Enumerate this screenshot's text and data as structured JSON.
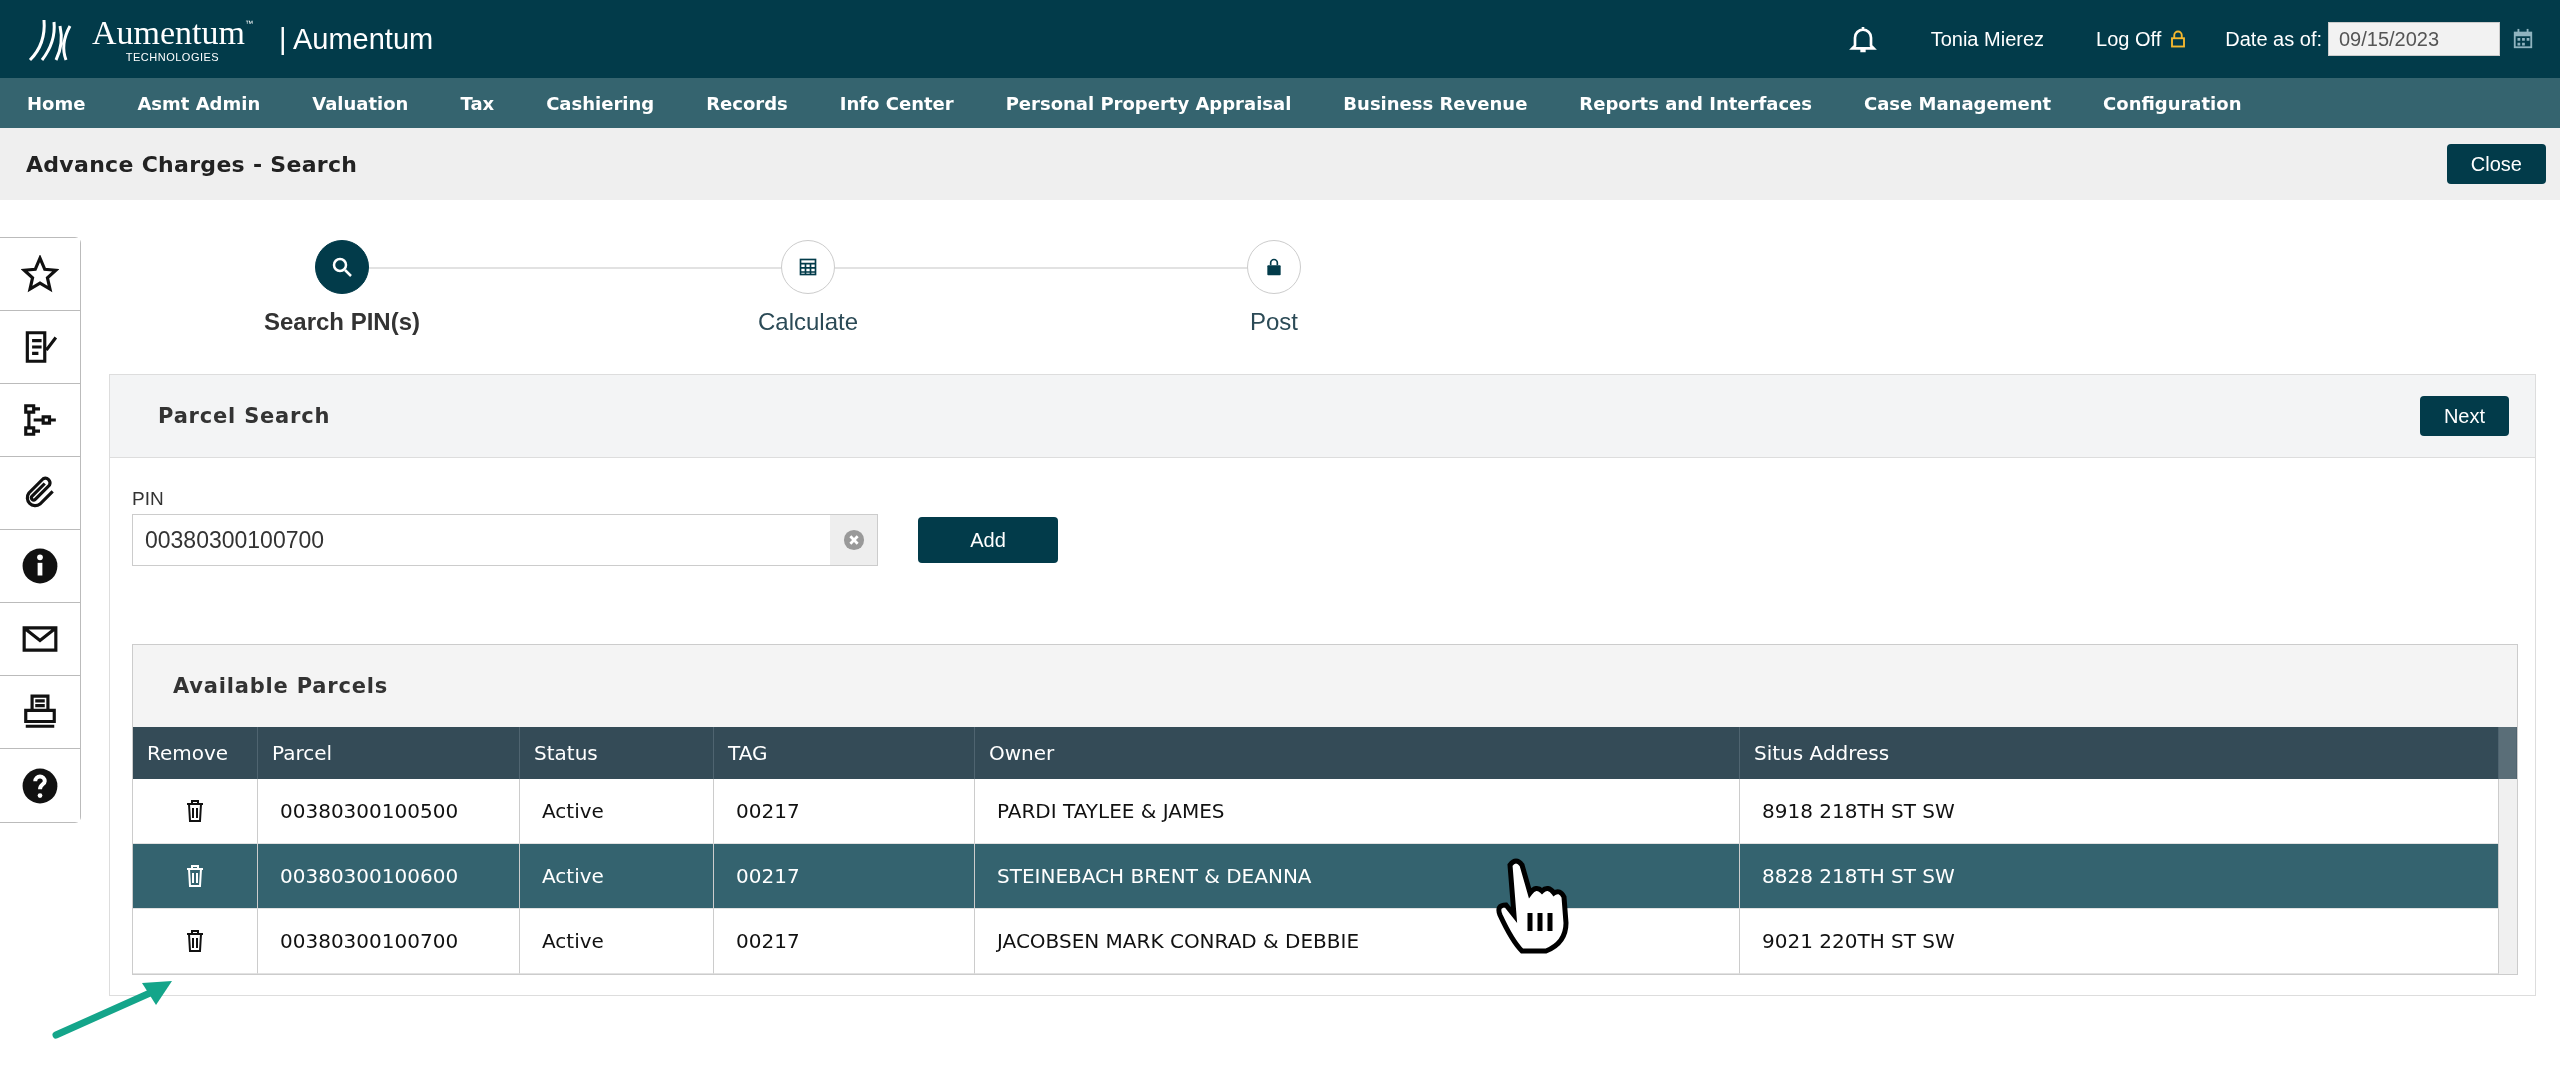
{
  "header": {
    "logo_word": "Aumentum",
    "logo_sub": "TECHNOLOGIES",
    "logo_tm": "™",
    "app_title": "| Aumentum",
    "user": "Tonia Mierez",
    "logoff": "Log Off",
    "date_label": "Date as of:",
    "date_value": "09/15/2023"
  },
  "nav": [
    "Home",
    "Asmt Admin",
    "Valuation",
    "Tax",
    "Cashiering",
    "Records",
    "Info Center",
    "Personal Property Appraisal",
    "Business Revenue",
    "Reports and Interfaces",
    "Case Management",
    "Configuration"
  ],
  "page": {
    "title": "Advance Charges - Search",
    "close": "Close"
  },
  "sidebar": [
    {
      "kind": "star"
    },
    {
      "kind": "note"
    },
    {
      "kind": "tree"
    },
    {
      "kind": "clip"
    },
    {
      "kind": "info"
    },
    {
      "kind": "mail"
    },
    {
      "kind": "print"
    },
    {
      "kind": "help"
    }
  ],
  "steps": [
    {
      "label": "Search PIN(s)",
      "kind": "search",
      "selected": true
    },
    {
      "label": "Calculate",
      "kind": "calc",
      "selected": false
    },
    {
      "label": "Post",
      "kind": "lock",
      "selected": false
    }
  ],
  "parcel_search": {
    "title": "Parcel Search",
    "next": "Next",
    "pin_label": "PIN",
    "pin_value": "00380300100700",
    "add": "Add"
  },
  "available": {
    "title": "Available Parcels",
    "columns": [
      "Remove",
      "Parcel",
      "Status",
      "TAG",
      "Owner",
      "Situs Address"
    ],
    "rows": [
      {
        "parcel": "00380300100500",
        "status": "Active",
        "tag": "00217",
        "owner": "PARDI TAYLEE & JAMES",
        "address": "8918 218TH ST SW",
        "selected": false
      },
      {
        "parcel": "00380300100600",
        "status": "Active",
        "tag": "00217",
        "owner": "STEINEBACH BRENT & DEANNA",
        "address": "8828 218TH ST SW",
        "selected": true
      },
      {
        "parcel": "00380300100700",
        "status": "Active",
        "tag": "00217",
        "owner": "JACOBSEN MARK CONRAD & DEBBIE",
        "address": "9021 220TH ST SW",
        "selected": false
      }
    ]
  }
}
